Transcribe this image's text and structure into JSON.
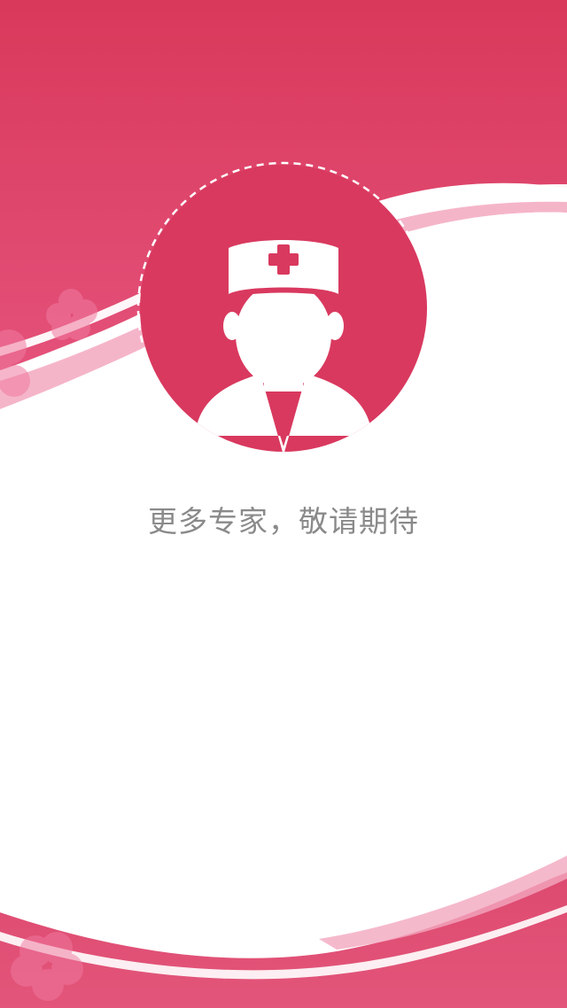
{
  "colors": {
    "brand": "#d9395f",
    "brand_light": "#e55a80",
    "text_muted": "#8a8a8a",
    "background": "#ffffff"
  },
  "placeholder": {
    "icon": "doctor-avatar-icon",
    "message": "更多专家，敬请期待"
  }
}
